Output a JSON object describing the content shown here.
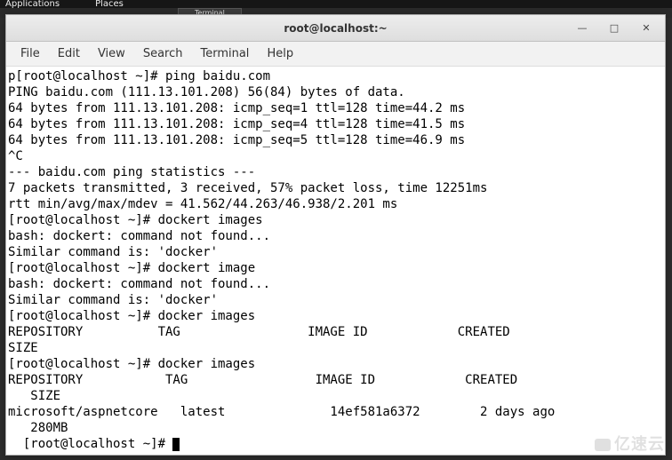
{
  "top_panel": {
    "applications": "Applications",
    "places": "Places"
  },
  "taskbar": {
    "terminal": "Terminal"
  },
  "window": {
    "title": "root@localhost:~"
  },
  "menubar": {
    "file": "File",
    "edit": "Edit",
    "view": "View",
    "search": "Search",
    "terminal": "Terminal",
    "help": "Help"
  },
  "win_controls": {
    "minimize": "—",
    "maximize": "□",
    "close": "✕"
  },
  "terminal": {
    "lines": [
      "p[root@localhost ~]# ping baidu.com",
      "PING baidu.com (111.13.101.208) 56(84) bytes of data.",
      "64 bytes from 111.13.101.208: icmp_seq=1 ttl=128 time=44.2 ms",
      "64 bytes from 111.13.101.208: icmp_seq=4 ttl=128 time=41.5 ms",
      "64 bytes from 111.13.101.208: icmp_seq=5 ttl=128 time=46.9 ms",
      "^C",
      "--- baidu.com ping statistics ---",
      "7 packets transmitted, 3 received, 57% packet loss, time 12251ms",
      "rtt min/avg/max/mdev = 41.562/44.263/46.938/2.201 ms",
      "[root@localhost ~]# dockert images",
      "bash: dockert: command not found...",
      "Similar command is: 'docker'",
      "[root@localhost ~]# dockert image",
      "bash: dockert: command not found...",
      "Similar command is: 'docker'",
      "[root@localhost ~]# docker images",
      "REPOSITORY          TAG                 IMAGE ID            CREATED",
      "SIZE",
      "[root@localhost ~]# docker images",
      "REPOSITORY           TAG                 IMAGE ID            CREATED",
      "   SIZE",
      "microsoft/aspnetcore   latest              14ef581a6372        2 days ago",
      "   280MB"
    ],
    "prompt": "  [root@localhost ~]# "
  },
  "watermark": "亿速云"
}
